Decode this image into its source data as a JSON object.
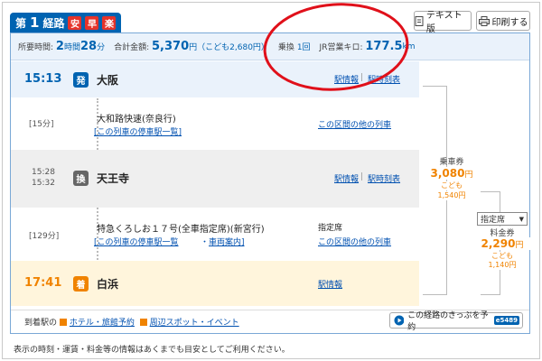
{
  "route": {
    "tab_label": "第",
    "tab_number": "1",
    "tab_suffix": "経路",
    "badges": [
      {
        "label": "安",
        "color": "#e6332a"
      },
      {
        "label": "早",
        "color": "#e6332a"
      },
      {
        "label": "楽",
        "color": "#e6332a"
      }
    ]
  },
  "header_buttons": {
    "text_version": "テキスト版",
    "print": "印刷する"
  },
  "summary": {
    "time_label": "所要時間:",
    "time_h": "2",
    "time_h_unit": "時間",
    "time_m": "28",
    "time_m_unit": "分",
    "total_label": "合計金額:",
    "total_value": "5,370",
    "total_unit": "円",
    "child_note": "（こども2,680円）",
    "transfer_label": "乗換",
    "transfer_value": "1回",
    "distance_label": "JR営業キロ:",
    "distance_value": "177.5",
    "distance_unit": "km"
  },
  "departure": {
    "time": "15:13",
    "badge": "発",
    "station": "大阪",
    "link1": "駅情報",
    "link2": "駅時刻表"
  },
  "leg1": {
    "duration": "[15分]",
    "train": "大和路快速(奈良行)",
    "stops_link": "[この列車の停車駅一覧]",
    "other_link": "この区間の他の列車"
  },
  "transfer": {
    "arrive": "15:28",
    "depart": "15:32",
    "badge": "換",
    "station": "天王寺",
    "link1": "駅情報",
    "link2": "駅時刻表"
  },
  "leg2": {
    "duration": "[129分]",
    "train": "特急くろしお１７号(全車指定席)(新宮行)",
    "stops_link_a": "[この列車の停車駅一覧",
    "stops_link_b": "車両案内]",
    "seat": "指定席",
    "other_link": "この区間の他の列車"
  },
  "arrival": {
    "time": "17:41",
    "badge": "着",
    "station": "白浜",
    "link1": "駅情報"
  },
  "fares": {
    "ticket_label": "乗車券",
    "ticket_value": "3,080",
    "ticket_child_label": "こども",
    "ticket_child_value": "1,540円",
    "seat_select": "指定席",
    "fee_label": "料金券",
    "fee_value": "2,290",
    "fee_child_label": "こども",
    "fee_child_value": "1,140円",
    "yen": "円"
  },
  "footer": {
    "label": "到着駅の",
    "hotel": "ホテル・旅館予約",
    "spots": "周辺スポット・イベント",
    "buy_button": "この経路のきっぷを予約",
    "logo": "e5489"
  },
  "note": "表示の時刻・運賃・料金等の情報はあくまでも目安としてご利用ください。",
  "colors": {
    "accent": "#0063b1",
    "fare": "#f08300",
    "annotation": "#e0101a"
  }
}
